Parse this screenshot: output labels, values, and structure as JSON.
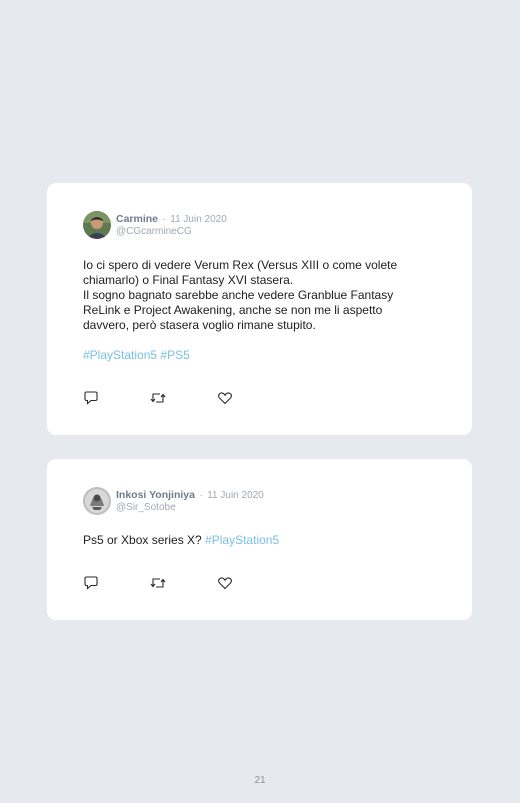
{
  "tweets": [
    {
      "name": "Carmine",
      "separator": "·",
      "date": "11 Juin 2020",
      "handle": "@CGcarmineCG",
      "lines": [
        "Io ci spero di vedere Verum Rex (Versus XIII o come volete",
        "chiamarlo) o Final Fantasy XVI stasera.",
        "Il sogno bagnato sarebbe anche vedere Granblue Fantasy",
        "ReLink e Project Awakening, anche se non me li aspetto",
        "davvero, però stasera voglio rimane stupito."
      ],
      "hashtags": [
        "#PlayStation5",
        "#PS5"
      ],
      "avatar_icon": "avatar-photo-person"
    },
    {
      "name": "Inkosi Yonjiniya",
      "separator": "·",
      "date": "11 Juin 2020",
      "handle": "@Sir_Sotobe",
      "text": "Ps5 or Xbox series X?",
      "hashtag": "#PlayStation5",
      "avatar_icon": "avatar-photo-grayscale"
    }
  ],
  "action_icons": [
    "reply-icon",
    "retweet-icon",
    "like-icon"
  ],
  "colors": {
    "background": "#e6e9ee",
    "card": "#ffffff",
    "hashtag": "#78bfe6",
    "meta": "#a0a8b2",
    "name": "#707c8a"
  },
  "page_number": "21"
}
